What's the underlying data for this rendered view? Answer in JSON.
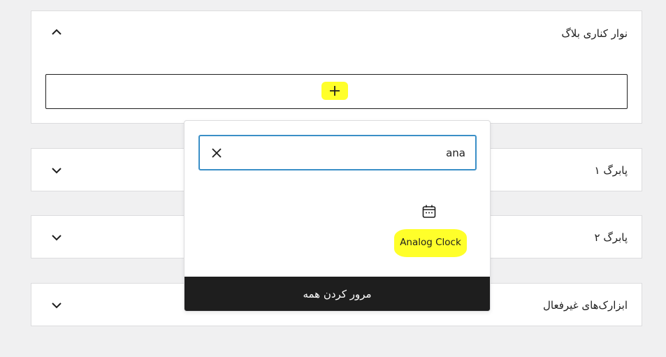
{
  "panels": {
    "sidebar": {
      "title": "نوار کناری بلاگ",
      "expanded": true
    },
    "footer1": {
      "title": "پابرگ ۱",
      "expanded": false
    },
    "footer2": {
      "title": "پابرگ ۲",
      "expanded": false
    },
    "inactive": {
      "title": "ابزارک‌های غیرفعال",
      "expanded": false
    }
  },
  "appender": {
    "icon": "plus-icon",
    "highlight_color": "#ffff2a"
  },
  "inserter": {
    "search_value": "ana",
    "clear_icon": "close-icon",
    "results": [
      {
        "label": "Analog Clock",
        "icon": "calendar-icon"
      }
    ],
    "browse_all_label": "مرور کردن همه"
  },
  "colors": {
    "accent": "#3a8fc7",
    "dark": "#1e1e1e",
    "highlight": "#ffff2a",
    "background": "#f0f0f1"
  }
}
